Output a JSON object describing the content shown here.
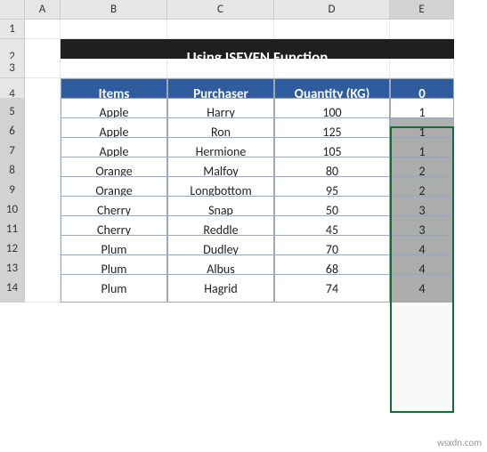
{
  "columns": [
    "A",
    "B",
    "C",
    "D",
    "E"
  ],
  "rows": [
    1,
    2,
    3,
    4,
    5,
    6,
    7,
    8,
    9,
    10,
    11,
    12,
    13,
    14
  ],
  "title": "Using ISEVEN Function",
  "headers": {
    "items": "Items",
    "purchaser": "Purchaser",
    "quantity": "Quantity (KG)",
    "helper": "0"
  },
  "data": [
    {
      "item": "Apple",
      "purchaser": "Harry",
      "qty": "100",
      "val": "1"
    },
    {
      "item": "Apple",
      "purchaser": "Ron",
      "qty": "125",
      "val": "1"
    },
    {
      "item": "Apple",
      "purchaser": "Hermione",
      "qty": "105",
      "val": "1"
    },
    {
      "item": "Orange",
      "purchaser": "Malfoy",
      "qty": "80",
      "val": "2"
    },
    {
      "item": "Orange",
      "purchaser": "Longbottom",
      "qty": "95",
      "val": "2"
    },
    {
      "item": "Cherry",
      "purchaser": "Snap",
      "qty": "50",
      "val": "3"
    },
    {
      "item": "Cherry",
      "purchaser": "Reddle",
      "qty": "45",
      "val": "3"
    },
    {
      "item": "Plum",
      "purchaser": "Dudley",
      "qty": "70",
      "val": "4"
    },
    {
      "item": "Plum",
      "purchaser": "Albus",
      "qty": "68",
      "val": "4"
    },
    {
      "item": "Plum",
      "purchaser": "Hagrid",
      "qty": "74",
      "val": "4"
    }
  ],
  "watermark": "wsxdn.com"
}
